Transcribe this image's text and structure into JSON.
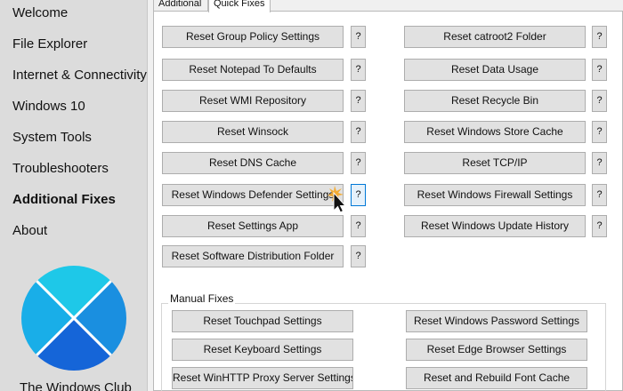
{
  "sidebar": {
    "items": [
      {
        "label": "Welcome",
        "active": false
      },
      {
        "label": "File Explorer",
        "active": false
      },
      {
        "label": "Internet & Connectivity",
        "active": false
      },
      {
        "label": "Windows 10",
        "active": false
      },
      {
        "label": "System Tools",
        "active": false
      },
      {
        "label": "Troubleshooters",
        "active": false
      },
      {
        "label": "Additional Fixes",
        "active": true
      },
      {
        "label": "About",
        "active": false
      }
    ],
    "logo_text": "The Windows Club",
    "logo_colors": {
      "top": "#1ec8e8",
      "left": "#19aee8",
      "right": "#1a8fe0",
      "bottom": "#1565d8"
    }
  },
  "tabs": [
    {
      "label": "Additional",
      "active": false
    },
    {
      "label": "Quick Fixes",
      "active": true
    }
  ],
  "quick_fixes": {
    "left": [
      "Reset Group Policy Settings",
      "Reset Notepad To Defaults",
      "Reset WMI Repository",
      "Reset Winsock",
      "Reset DNS Cache",
      "Reset Windows Defender Settings",
      "Reset Settings App",
      "Reset Software Distribution Folder"
    ],
    "right": [
      "Reset catroot2 Folder",
      "Reset Data Usage",
      "Reset Recycle Bin",
      "Reset Windows Store Cache",
      "Reset TCP/IP",
      "Reset Windows Firewall Settings",
      "Reset Windows Update History"
    ],
    "help_label": "?"
  },
  "manual_fixes": {
    "group_label": "Manual Fixes",
    "left": [
      "Reset Touchpad Settings",
      "Reset Keyboard Settings",
      "Reset WinHTTP Proxy Server Settings"
    ],
    "right": [
      "Reset Windows Password Settings",
      "Reset Edge Browser Settings",
      "Reset and Rebuild Font Cache"
    ]
  }
}
